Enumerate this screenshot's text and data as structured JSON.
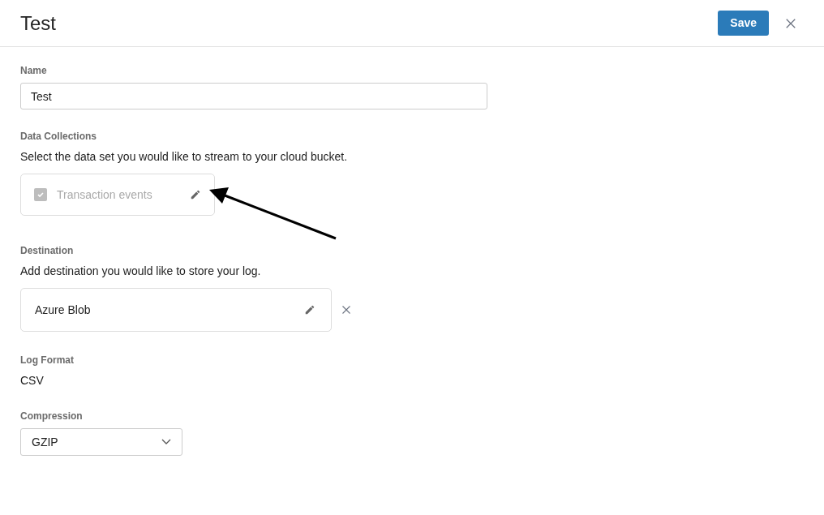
{
  "header": {
    "title": "Test",
    "save_button": "Save"
  },
  "name": {
    "label": "Name",
    "value": "Test"
  },
  "data_collections": {
    "label": "Data Collections",
    "description": "Select the data set you would like to stream to your cloud bucket.",
    "items": [
      {
        "label": "Transaction events",
        "checked": true,
        "disabled": true
      }
    ]
  },
  "destination": {
    "label": "Destination",
    "description": "Add destination you would like to store your log.",
    "value": "Azure Blob"
  },
  "log_format": {
    "label": "Log Format",
    "value": "CSV"
  },
  "compression": {
    "label": "Compression",
    "value": "GZIP"
  }
}
